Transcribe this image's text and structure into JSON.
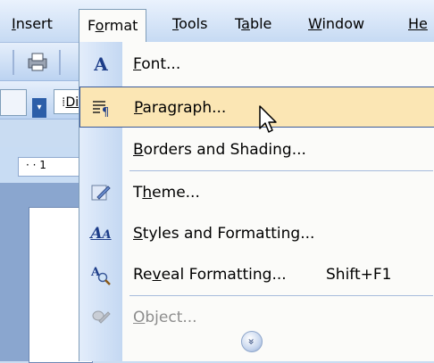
{
  "menubar": {
    "items": [
      {
        "label": "Insert",
        "mnemonic": "I"
      },
      {
        "label": "Format",
        "mnemonic": "o"
      },
      {
        "label": "Tools",
        "mnemonic": "T"
      },
      {
        "label": "Table",
        "mnemonic": "a"
      },
      {
        "label": "Window",
        "mnemonic": "W"
      },
      {
        "label": "He",
        "mnemonic": "H"
      }
    ],
    "open": "Format"
  },
  "toolbar": {
    "style_field_partial": "Di",
    "ruler_marks": "· · 1"
  },
  "format_menu": {
    "items": [
      {
        "before": "",
        "mn": "F",
        "after": "ont...",
        "icon": "font-A-icon",
        "shortcut": ""
      },
      {
        "before": "",
        "mn": "P",
        "after": "aragraph...",
        "icon": "paragraph-icon",
        "shortcut": "",
        "highlighted": true
      },
      {
        "before": "",
        "mn": "B",
        "after": "orders and Shading...",
        "icon": "",
        "shortcut": ""
      },
      {
        "before": "T",
        "mn": "h",
        "after": "eme...",
        "icon": "theme-icon",
        "shortcut": ""
      },
      {
        "before": "",
        "mn": "S",
        "after": "tyles and Formatting...",
        "icon": "styles-icon",
        "shortcut": ""
      },
      {
        "before": "Re",
        "mn": "v",
        "after": "eal Formatting...",
        "icon": "reveal-formatting-icon",
        "shortcut": "Shift+F1"
      },
      {
        "before": "",
        "mn": "O",
        "after": "bject...",
        "icon": "object-icon",
        "shortcut": "",
        "disabled": true
      }
    ],
    "expand_glyph": "»"
  },
  "colors": {
    "highlight": "#fbe6b4",
    "highlight_border": "#3b5a9a",
    "menubar": "#c6daf3",
    "gutter": "#c4d8f2"
  }
}
